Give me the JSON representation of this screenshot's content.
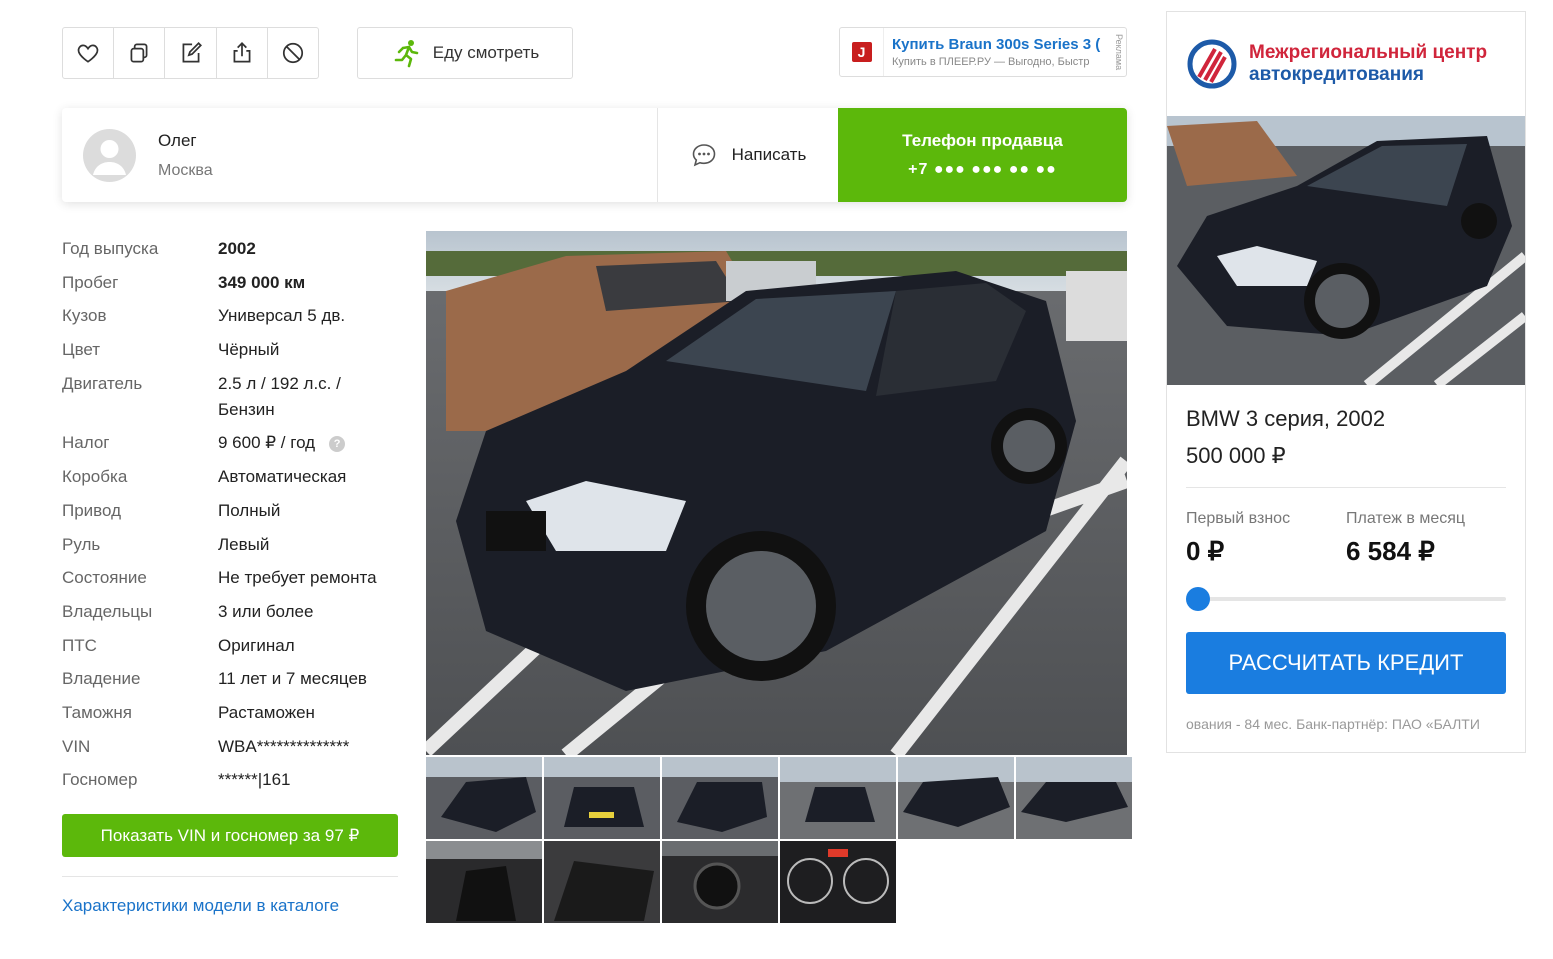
{
  "toolbar": {
    "icons": [
      "heart-icon",
      "compare-icon",
      "edit-icon",
      "share-icon",
      "block-icon"
    ]
  },
  "watch_button": {
    "label": "Еду смотреть",
    "icon": "running-man-icon",
    "icon_color": "#5cb80b"
  },
  "top_ad": {
    "title": "Купить Braun 300s Series 3 (",
    "subtitle": "Купить в ПЛЕЕР.РУ — Выгодно, Быстр",
    "mark": "Реклама"
  },
  "seller": {
    "name": "Олег",
    "city": "Москва",
    "write_label": "Написать",
    "phone_title": "Телефон продавца",
    "phone_masked": "+7 ●●● ●●● ●● ●●",
    "accent": "#5cb80b"
  },
  "specs": [
    {
      "label": "Год выпуска",
      "value": "2002",
      "bold": true
    },
    {
      "label": "Пробег",
      "value": "349 000 км",
      "bold": true
    },
    {
      "label": "Кузов",
      "value": "Универсал 5 дв."
    },
    {
      "label": "Цвет",
      "value": "Чёрный"
    },
    {
      "label": "Двигатель",
      "value": "2.5 л / 192 л.с. / Бензин"
    },
    {
      "label": "Налог",
      "value": "9 600 ₽ / год",
      "help": "?"
    },
    {
      "label": "Коробка",
      "value": "Автоматическая"
    },
    {
      "label": "Привод",
      "value": "Полный"
    },
    {
      "label": "Руль",
      "value": "Левый"
    },
    {
      "label": "Состояние",
      "value": "Не требует ремонта"
    },
    {
      "label": "Владельцы",
      "value": "3 или более"
    },
    {
      "label": "ПТС",
      "value": "Оригинал"
    },
    {
      "label": "Владение",
      "value": "11 лет и 7 месяцев"
    },
    {
      "label": "Таможня",
      "value": "Растаможен"
    },
    {
      "label": "VIN",
      "value": "WBA**************"
    },
    {
      "label": "Госномер",
      "value": "******|161"
    }
  ],
  "vin_button": "Показать VIN и госномер за 97 ₽",
  "catalog_link": "Характеристики модели в каталоге",
  "credit_ad": {
    "brand_line1": "Межрегиональный центр",
    "brand_line2": "автокредитования",
    "car_title": "BMW 3 серия, 2002",
    "price": "500 000 ₽",
    "down_payment_label": "Первый взнос",
    "down_payment_value": "0 ₽",
    "monthly_label": "Платеж в месяц",
    "monthly_value": "6 584 ₽",
    "slider_fraction": 0,
    "button": "РАССЧИТАТЬ КРЕДИТ",
    "footer": "ования - 84 мес. Банк-партнёр: ПАО «БАЛТИ",
    "button_color": "#1a7de0"
  }
}
